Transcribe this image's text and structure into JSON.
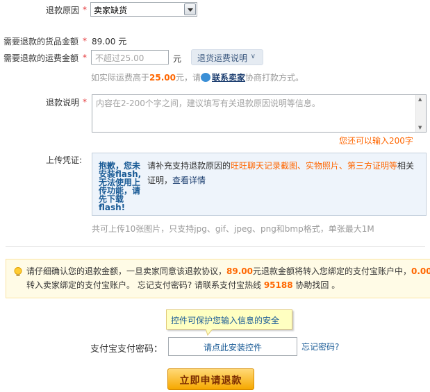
{
  "form": {
    "refund_reason": {
      "label": "退款原因",
      "required": "*",
      "value": "卖家缺货"
    },
    "goods_amount": {
      "label": "需要退款的货品金额",
      "required": "*",
      "value": "89.00",
      "unit": "元"
    },
    "shipping_amount": {
      "label": "需要退款的运费金额",
      "required": "*",
      "placeholder": "不超过25.00",
      "unit": "元",
      "policy_button": "退货运费说明",
      "hint_prefix": "如实际运费高于",
      "hint_amount": "25.00",
      "hint_mid": "元，请",
      "contact_link": "联系卖家",
      "hint_suffix": "协商打款方式。"
    },
    "description": {
      "label": "退款说明",
      "required": "*",
      "placeholder": "内容在2-200个字之间，建议填写有关退款原因说明等信息。",
      "remaining": "您还可以输入200字"
    },
    "upload": {
      "label": "上传凭证:",
      "flash_message": "抱歉，您未安装flash,无法使用上传功能，请先下载flash!",
      "text_before": "请补充支持退款原因的",
      "text_highlight": "旺旺聊天记录截图、实物照片、第三方证明等",
      "text_after": "相关证明，",
      "details_link": "查看详情",
      "constraints": "共可上传10张图片，只支持jpg、gif、jpeg、png和bmp格式，单张最大1M"
    }
  },
  "notice": {
    "line1_a": "请仔细确认您的退款金额，一旦卖家同意该退款协议，",
    "amount": "89.00",
    "line1_b": "元退款金额将转入您绑定的支付宝账户中，",
    "amount2": "0.00",
    "line2_a": "转入卖家绑定的支付宝账户。 忘记支付密码? 请联系支付宝热线 ",
    "hotline": "95188",
    "line2_b": " 协助找回 。"
  },
  "payment": {
    "tooltip": "控件可保护您输入信息的安全",
    "password_label": "支付宝支付密码：",
    "install_prompt": "请点此安装控件",
    "forgot_link": "忘记密码?",
    "submit_label": "立即申请退款"
  },
  "colors": {
    "accent_orange": "#ff6600",
    "link_blue": "#1a5b96",
    "required_red": "#e4393c"
  }
}
